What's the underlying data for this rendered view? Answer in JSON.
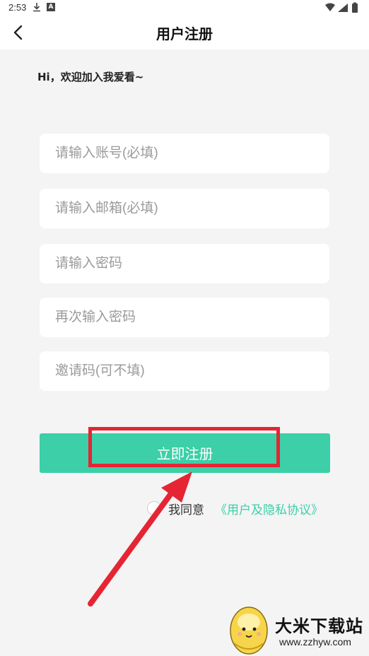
{
  "status_bar": {
    "time": "2:53"
  },
  "nav": {
    "title": "用户注册"
  },
  "welcome": "Hi，欢迎加入我爱看~",
  "form": {
    "account_placeholder": "请输入账号(必填)",
    "email_placeholder": "请输入邮箱(必填)",
    "password_placeholder": "请输入密码",
    "confirm_password_placeholder": "再次输入密码",
    "invite_code_placeholder": "邀请码(可不填)",
    "submit_label": "立即注册"
  },
  "agreement": {
    "prefix": "我同意",
    "link": "《用户及隐私协议》",
    "checked": false
  },
  "watermark": {
    "title": "大米下载站",
    "url": "www.zzhyw.com"
  },
  "colors": {
    "accent": "#3ccfa8",
    "annotation_red": "#e52534"
  }
}
